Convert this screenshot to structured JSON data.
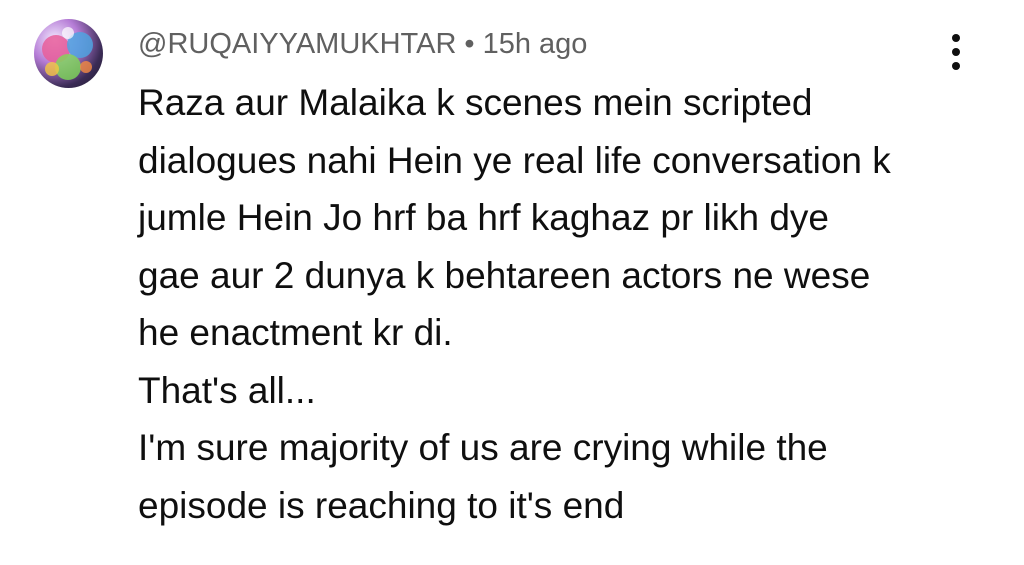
{
  "comment": {
    "author": "@RUQAIYYAMUKHTAR",
    "separator": "•",
    "timestamp": "15h ago",
    "lines": [
      "Raza aur Malaika k scenes mein scripted",
      "dialogues nahi Hein ye real life conversation k",
      "jumle Hein Jo hrf ba hrf kaghaz pr likh dye",
      "gae aur 2 dunya k behtareen actors ne wese",
      "he enactment kr di.",
      "That's all...",
      "I'm sure majority of us are crying while the",
      "episode is reaching to it's end"
    ],
    "menu_icon": "more-vert-icon",
    "avatar_icon": "user-avatar"
  },
  "colors": {
    "meta_text": "#606060",
    "body_text": "#0f0f0f",
    "background": "#ffffff"
  }
}
